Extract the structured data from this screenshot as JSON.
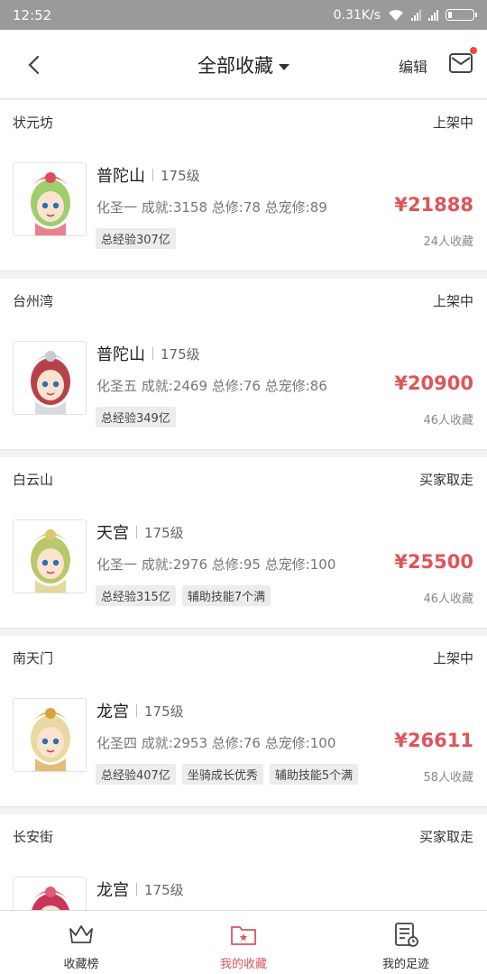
{
  "status_bar": {
    "time": "12:52",
    "speed": "0.31K/s"
  },
  "nav": {
    "title": "全部收藏",
    "edit_label": "编辑"
  },
  "items": [
    {
      "server": "状元坊",
      "status": "上架中",
      "school": "普陀山",
      "level": "175级",
      "stats": "化圣一 成就:3158 总修:78 总宠修:89",
      "tags": [
        "总经验307亿"
      ],
      "price": "¥21888",
      "favs": "24人收藏",
      "hair": "#9ccf6a",
      "crown": "#e04a5a"
    },
    {
      "server": "台州湾",
      "status": "上架中",
      "school": "普陀山",
      "level": "175级",
      "stats": "化圣五 成就:2469 总修:76 总宠修:86",
      "tags": [
        "总经验349亿"
      ],
      "price": "¥20900",
      "favs": "46人收藏",
      "hair": "#b7414b",
      "crown": "#c9c9d6"
    },
    {
      "server": "白云山",
      "status": "买家取走",
      "school": "天宫",
      "level": "175级",
      "stats": "化圣一 成就:2976 总修:95 总宠修:100",
      "tags": [
        "总经验315亿",
        "辅助技能7个满"
      ],
      "price": "¥25500",
      "favs": "46人收藏",
      "hair": "#b8c86a",
      "crown": "#d9c870"
    },
    {
      "server": "南天门",
      "status": "上架中",
      "school": "龙宫",
      "level": "175级",
      "stats": "化圣四 成就:2953 总修:76 总宠修:100",
      "tags": [
        "总经验407亿",
        "坐骑成长优秀",
        "辅助技能5个满"
      ],
      "price": "¥26611",
      "favs": "58人收藏",
      "hair": "#e8d9a0",
      "crown": "#d9a33c"
    },
    {
      "server": "长安街",
      "status": "买家取走",
      "school": "龙宫",
      "level": "175级",
      "stats": "",
      "tags": [],
      "price": "",
      "favs": "",
      "hair": "#c8365a",
      "crown": "#e05a7a"
    }
  ],
  "tabs": [
    {
      "label": "收藏榜",
      "icon": "crown-icon",
      "active": false
    },
    {
      "label": "我的收藏",
      "icon": "folder-star-icon",
      "active": true
    },
    {
      "label": "我的足迹",
      "icon": "history-icon",
      "active": false
    }
  ],
  "colors": {
    "accent": "#e0545a",
    "status_bar": "#9a9a9a"
  }
}
